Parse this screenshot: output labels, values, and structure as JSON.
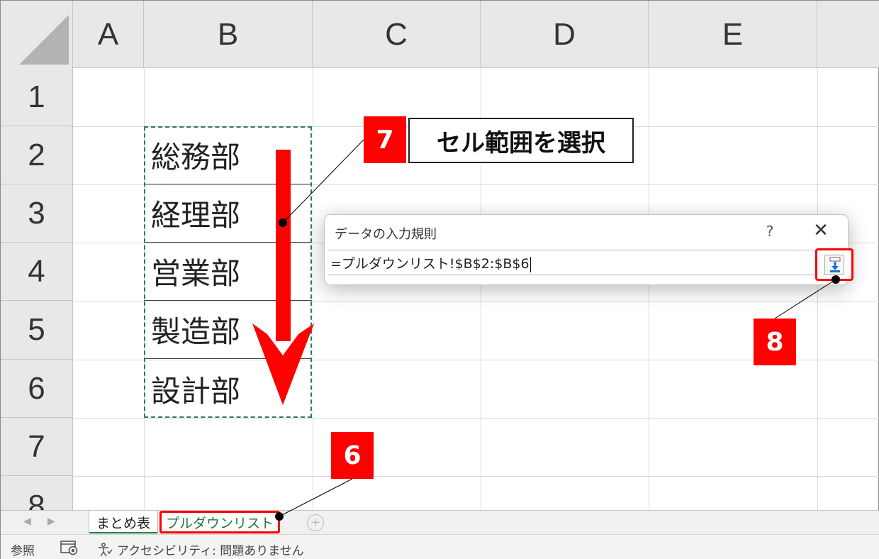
{
  "columns": [
    "A",
    "B",
    "C",
    "D",
    "E"
  ],
  "rows": [
    "1",
    "2",
    "3",
    "4",
    "5",
    "6",
    "7",
    "8"
  ],
  "cells_b": [
    "総務部",
    "経理部",
    "営業部",
    "製造部",
    "設計部"
  ],
  "sheet_tabs": {
    "summary": "まとめ表",
    "active": "プルダウンリスト"
  },
  "dialog": {
    "title": "データの入力規則",
    "help": "?",
    "close": "✕",
    "formula": "=プルダウンリスト!$B$2:$B$6"
  },
  "status": {
    "mode": "参照",
    "accessibility": "アクセシビリティ: 問題ありません"
  },
  "annotations": {
    "step7_number": "7",
    "step7_text": "セル範囲を選択",
    "step8_number": "8",
    "step6_number": "6"
  },
  "colors": {
    "accent_red": "#ff0000",
    "selection_green": "#2e7d4f",
    "tab_green": "#217346"
  },
  "icons": [
    "add-sheet-icon",
    "macro-record-icon",
    "accessibility-icon",
    "collapse-dialog-icon",
    "close-icon",
    "help-icon"
  ]
}
